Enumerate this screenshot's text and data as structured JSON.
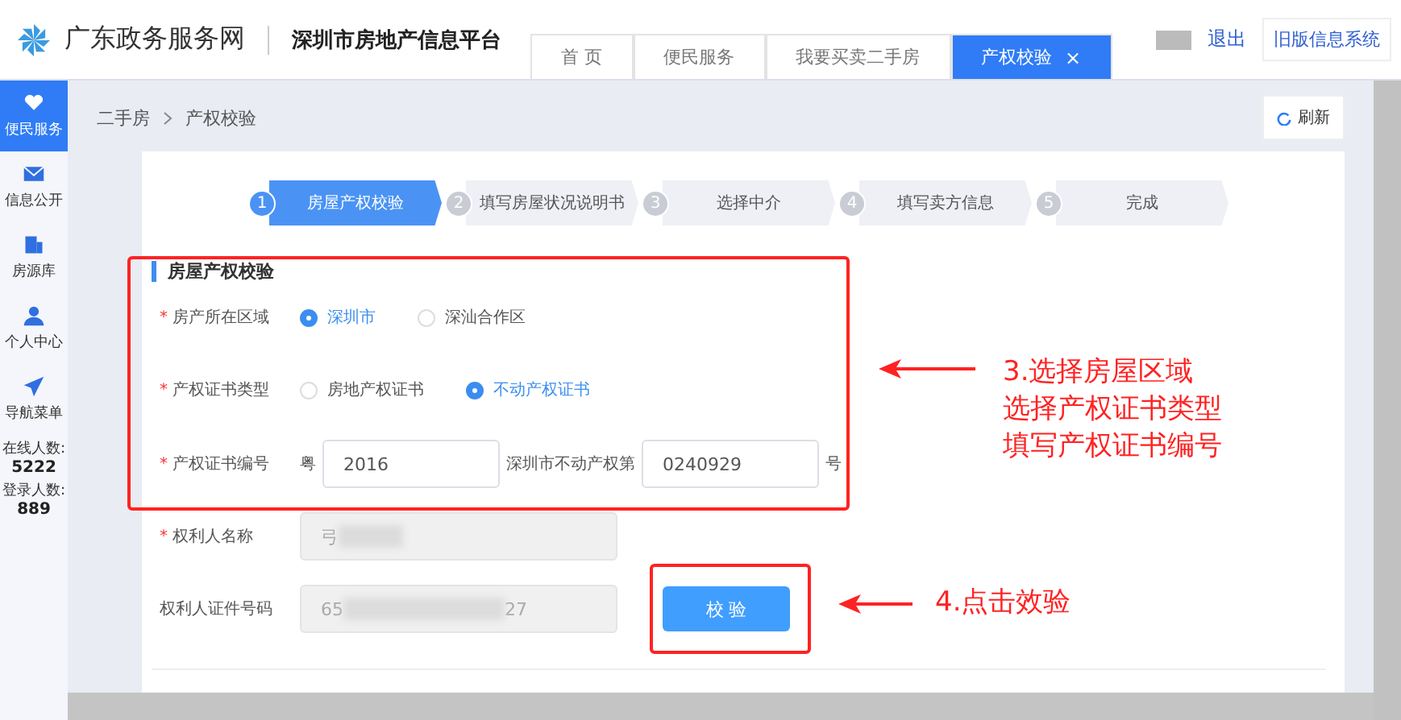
{
  "header": {
    "site_name": "广东政务服务网",
    "platform_name": "深圳市房地产信息平台",
    "logout": "退出",
    "old_system_button": "旧版信息系统"
  },
  "tabs": [
    {
      "label": "首 页",
      "selected": false
    },
    {
      "label": "便民服务",
      "selected": false
    },
    {
      "label": "我要买卖二手房",
      "selected": false
    },
    {
      "label": "产权校验",
      "selected": true,
      "close_glyph": "×"
    }
  ],
  "sidebar": {
    "items": [
      {
        "label": "便民服务",
        "selected": true
      },
      {
        "label": "信息公开",
        "selected": false
      },
      {
        "label": "房源库",
        "selected": false
      },
      {
        "label": "个人中心",
        "selected": false
      },
      {
        "label": "导航菜单",
        "selected": false
      }
    ],
    "stats": [
      {
        "label": "在线人数:",
        "value": "5222"
      },
      {
        "label": "登录人数:",
        "value": "889"
      }
    ]
  },
  "breadcrumb": [
    "二手房",
    "产权校验"
  ],
  "refresh_button": "刷新",
  "steps": [
    {
      "number": "1",
      "label": "房屋产权校验",
      "selected": true
    },
    {
      "number": "2",
      "label": "填写房屋状况说明书",
      "selected": false
    },
    {
      "number": "3",
      "label": "选择中介",
      "selected": false
    },
    {
      "number": "4",
      "label": "填写卖方信息",
      "selected": false
    },
    {
      "number": "5",
      "label": "完成",
      "selected": false
    }
  ],
  "form": {
    "section_title": "房屋产权校验",
    "rows": [
      {
        "kind": "radio",
        "label": "房产所在区域",
        "required_mark": "*",
        "options": [
          {
            "label": "深圳市",
            "selected": true
          },
          {
            "label": "深汕合作区",
            "selected": false
          }
        ]
      },
      {
        "kind": "radio",
        "label": "产权证书类型",
        "required_mark": "*",
        "options": [
          {
            "label": "房地产权证书",
            "selected": false
          },
          {
            "label": "不动产权证书",
            "selected": true
          }
        ]
      },
      {
        "kind": "cert",
        "label": "产权证书编号",
        "required_mark": "*",
        "prefix": "粤",
        "value_1": "2016",
        "middle": "深圳市不动产权第",
        "value_2": "0240929",
        "suffix": "号"
      },
      {
        "kind": "masked",
        "label": "权利人名称",
        "required_mark": "*",
        "value_start": "弓",
        "value_end": ""
      },
      {
        "kind": "masked",
        "label": "权利人证件号码",
        "value_start": "65",
        "value_end": "27",
        "button": "校 验"
      }
    ]
  },
  "annotations": [
    {
      "lines": [
        "3.选择房屋区域",
        "选择产权证书类型",
        "填写产权证书编号"
      ]
    },
    {
      "lines": [
        "4.点击效验"
      ]
    }
  ]
}
